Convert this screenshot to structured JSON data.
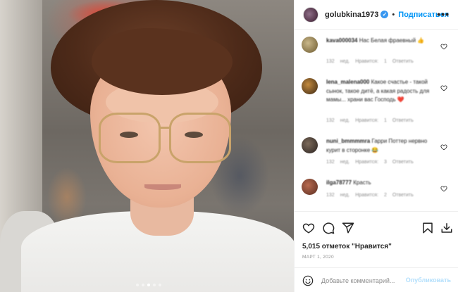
{
  "post": {
    "image_alt": "",
    "carousel_dots": 5,
    "carousel_active_index": 2
  },
  "header": {
    "username": "golubkina1973",
    "verified_mark": "✓",
    "separator": "•",
    "follow_label": "Подписаться",
    "more_label": "•••"
  },
  "comments": [
    {
      "username": "kava000034",
      "text": "Нас Белая фрaевный",
      "emoji": "👍",
      "meta": "132 нед. Нравится: 1 Ответить"
    },
    {
      "username": "lena_malena000",
      "text": "Какое счастье - такой сынок, такое дитё, а какая радость для мамы... храни вас Господь",
      "emoji": "❤️",
      "meta": "132 нед. Нравится: 1 Ответить"
    },
    {
      "username": "nuni_bmmmmra",
      "text": "Гарри Поттер нервно курит в сторонке",
      "emoji": "😂",
      "meta": "132 нед. Нравится: 3 Ответить"
    },
    {
      "username": "ilga78777",
      "text": "Красть",
      "emoji": "",
      "meta": "132 нед. Нравится: 2 Ответить"
    }
  ],
  "actions": {
    "likes_text": "5,015 отметок \"Нравится\"",
    "date": "МАРТ 1, 2020"
  },
  "add_comment": {
    "placeholder": "Добавьте комментарий...",
    "publish_label": "Опубликовать"
  },
  "colors": {
    "link_blue": "#0095f6",
    "publish_disabled": "#b2dffc",
    "border": "#efefef",
    "muted_text": "#8e8e8e",
    "heart_red": "#ed4956"
  }
}
